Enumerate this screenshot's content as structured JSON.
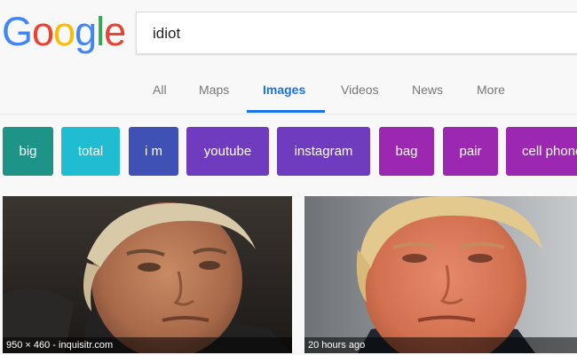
{
  "logo": {
    "letters": [
      {
        "ch": "G",
        "color": "#4285F4"
      },
      {
        "ch": "o",
        "color": "#EA4335"
      },
      {
        "ch": "o",
        "color": "#FBBC05"
      },
      {
        "ch": "g",
        "color": "#4285F4"
      },
      {
        "ch": "l",
        "color": "#34A853"
      },
      {
        "ch": "e",
        "color": "#EA4335"
      }
    ]
  },
  "search": {
    "value": "idiot"
  },
  "tabs": [
    {
      "label": "All",
      "active": false
    },
    {
      "label": "Maps",
      "active": false
    },
    {
      "label": "Images",
      "active": true
    },
    {
      "label": "Videos",
      "active": false
    },
    {
      "label": "News",
      "active": false
    },
    {
      "label": "More",
      "active": false
    }
  ],
  "chips": [
    {
      "label": "big",
      "color": "#1e9488"
    },
    {
      "label": "total",
      "color": "#1fbcd2"
    },
    {
      "label": "i m",
      "color": "#3f51b5"
    },
    {
      "label": "youtube",
      "color": "#6f3cbf"
    },
    {
      "label": "instagram",
      "color": "#6f3cbf"
    },
    {
      "label": "bag",
      "color": "#9c27b0"
    },
    {
      "label": "pair",
      "color": "#9c27b0"
    },
    {
      "label": "cell phone",
      "color": "#9c27b0"
    }
  ],
  "results": [
    {
      "caption": "950 × 460 - inquisitr.com"
    },
    {
      "caption": "20 hours ago"
    }
  ]
}
